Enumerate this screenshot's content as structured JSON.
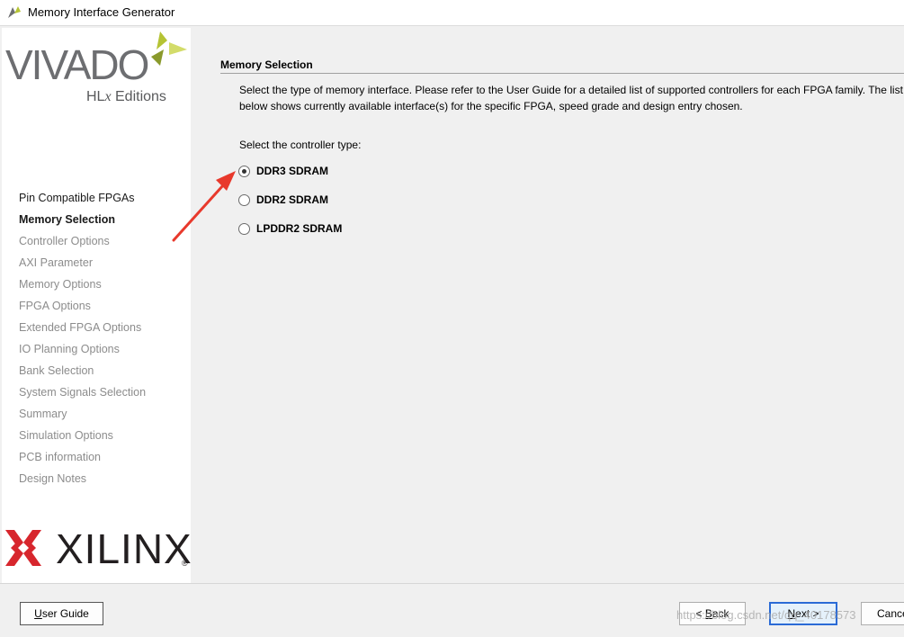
{
  "window": {
    "title": "Memory Interface Generator"
  },
  "branding": {
    "vivado_word": "VIVADO",
    "vivado_sub_prefix": "HL",
    "vivado_sub_x": "x",
    "vivado_sub_suffix": " Editions",
    "xilinx_word": "XILINX",
    "xilinx_reg": "®"
  },
  "steps": [
    {
      "label": "Pin Compatible FPGAs",
      "state": "done"
    },
    {
      "label": "Memory Selection",
      "state": "active"
    },
    {
      "label": "Controller Options",
      "state": "pending"
    },
    {
      "label": "AXI Parameter",
      "state": "pending"
    },
    {
      "label": "Memory Options",
      "state": "pending"
    },
    {
      "label": "FPGA Options",
      "state": "pending"
    },
    {
      "label": "Extended FPGA Options",
      "state": "pending"
    },
    {
      "label": "IO Planning Options",
      "state": "pending"
    },
    {
      "label": "Bank Selection",
      "state": "pending"
    },
    {
      "label": "System Signals Selection",
      "state": "pending"
    },
    {
      "label": "Summary",
      "state": "pending"
    },
    {
      "label": "Simulation Options",
      "state": "pending"
    },
    {
      "label": "PCB information",
      "state": "pending"
    },
    {
      "label": "Design Notes",
      "state": "pending"
    }
  ],
  "main": {
    "section_title": "Memory Selection",
    "description": "Select the type of memory interface. Please refer to the User Guide for a detailed list of supported controllers for each FPGA family. The list below shows currently available interface(s) for the specific FPGA, speed grade and design entry chosen.",
    "prompt": "Select the controller type:",
    "options": [
      {
        "label": "DDR3 SDRAM",
        "selected": true
      },
      {
        "label": "DDR2 SDRAM",
        "selected": false
      },
      {
        "label": "LPDDR2 SDRAM",
        "selected": false
      }
    ]
  },
  "footer": {
    "user_guide_label": "User Guide",
    "back_label": "< Back",
    "next_label": "Next >",
    "cancel_label": "Cance",
    "watermark": "https://blog.csdn.net/qq_40178573"
  },
  "colors": {
    "arrow": "#e8392c",
    "vivado_leaf": "#b5c334",
    "xilinx_red": "#d7262d",
    "next_border": "#2b6bd6"
  }
}
